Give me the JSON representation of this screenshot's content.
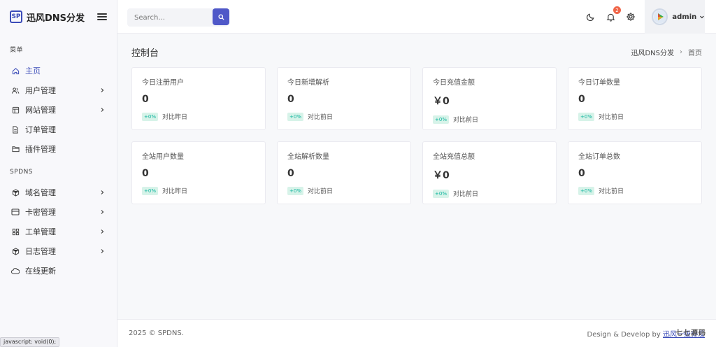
{
  "brand": {
    "logo": "SP",
    "name": "迅风DNS分发"
  },
  "sidebar": {
    "section1": "菜单",
    "section2": "SPDNS",
    "items1": [
      {
        "label": "主页",
        "icon": "home-icon",
        "chevron": false,
        "active": true
      },
      {
        "label": "用户管理",
        "icon": "users-icon",
        "chevron": true
      },
      {
        "label": "网站管理",
        "icon": "layout-icon",
        "chevron": true
      },
      {
        "label": "订单管理",
        "icon": "file-icon",
        "chevron": false
      },
      {
        "label": "插件管理",
        "icon": "folder-icon",
        "chevron": false
      }
    ],
    "items2": [
      {
        "label": "域名管理",
        "icon": "cube-icon",
        "chevron": true
      },
      {
        "label": "卡密管理",
        "icon": "card-icon",
        "chevron": true
      },
      {
        "label": "工单管理",
        "icon": "grid-icon",
        "chevron": true
      },
      {
        "label": "日志管理",
        "icon": "box-icon",
        "chevron": true
      },
      {
        "label": "在线更新",
        "icon": "cloud-icon",
        "chevron": false
      }
    ]
  },
  "topbar": {
    "search_placeholder": "Search...",
    "notification_count": "2",
    "user_name": "admin"
  },
  "page": {
    "title": "控制台",
    "breadcrumb_root": "迅风DNS分发",
    "breadcrumb_current": "首页"
  },
  "cards": [
    {
      "title": "今日注册用户",
      "value": "0",
      "pct": "+0%",
      "compare": "对比昨日"
    },
    {
      "title": "今日新增解析",
      "value": "0",
      "pct": "+0%",
      "compare": "对比前日"
    },
    {
      "title": "今日充值金额",
      "value": "￥0",
      "pct": "+0%",
      "compare": "对比前日"
    },
    {
      "title": "今日订单数量",
      "value": "0",
      "pct": "+0%",
      "compare": "对比前日"
    },
    {
      "title": "全站用户数量",
      "value": "0",
      "pct": "+0%",
      "compare": "对比昨日"
    },
    {
      "title": "全站解析数量",
      "value": "0",
      "pct": "+0%",
      "compare": "对比前日"
    },
    {
      "title": "全站充值总额",
      "value": "￥0",
      "pct": "+0%",
      "compare": "对比前日"
    },
    {
      "title": "全站订单总数",
      "value": "0",
      "pct": "+0%",
      "compare": "对比前日"
    }
  ],
  "footer": {
    "copyright": "2025 © SPDNS.",
    "dev_text": "Design & Develop by",
    "dev_link": "迅风一级分发"
  },
  "statusbar": "javascript: void(0);",
  "watermark": "七七源码",
  "colors": {
    "accent": "#4f58c8",
    "badge": "#f06548",
    "success": "#0ab39c"
  }
}
